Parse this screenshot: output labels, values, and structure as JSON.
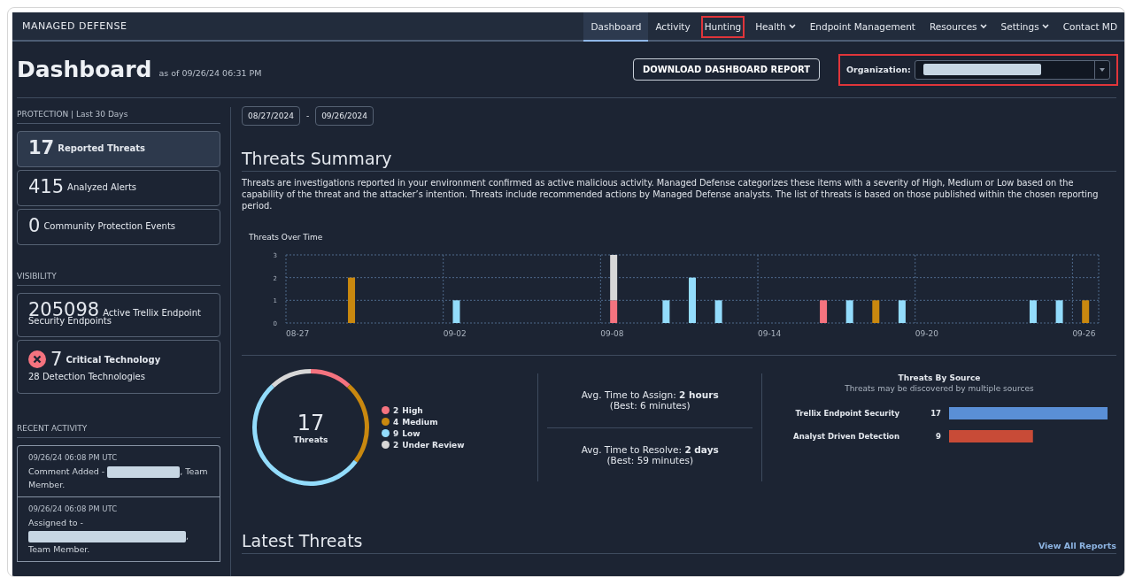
{
  "app": {
    "title": "MANAGED DEFENSE"
  },
  "nav": [
    {
      "label": "Dashboard",
      "selected": true,
      "dropdown": false,
      "highlighted": false
    },
    {
      "label": "Activity",
      "selected": false,
      "dropdown": false,
      "highlighted": false
    },
    {
      "label": "Hunting",
      "selected": false,
      "dropdown": false,
      "highlighted": true
    },
    {
      "label": "Health",
      "selected": false,
      "dropdown": true,
      "highlighted": false
    },
    {
      "label": "Endpoint Management",
      "selected": false,
      "dropdown": false,
      "highlighted": false
    },
    {
      "label": "Resources",
      "selected": false,
      "dropdown": true,
      "highlighted": false
    },
    {
      "label": "Settings",
      "selected": false,
      "dropdown": true,
      "highlighted": false
    },
    {
      "label": "Contact MD",
      "selected": false,
      "dropdown": false,
      "highlighted": false
    }
  ],
  "header": {
    "title": "Dashboard",
    "timestamp": "as of 09/26/24 06:31 PM",
    "download_button": "DOWNLOAD DASHBOARD REPORT",
    "organization": {
      "label": "Organization:",
      "redacted": true,
      "highlighted": true
    }
  },
  "protection": {
    "title": "PROTECTION | Last 30 Days",
    "cards": [
      {
        "value": "17",
        "label": "Reported Threats",
        "selected": true
      },
      {
        "value": "415",
        "label": "Analyzed Alerts",
        "selected": false
      },
      {
        "value": "0",
        "label": "Community Protection Events",
        "selected": false
      }
    ]
  },
  "visibility": {
    "title": "VISIBILITY",
    "cards": [
      {
        "kind": "count",
        "value": "205098",
        "label": "Active Trellix Endpoint Security Endpoints"
      },
      {
        "kind": "critical",
        "value": "7",
        "label": "Critical Technology",
        "sub": "28 Detection Technologies"
      }
    ]
  },
  "recent_activity": {
    "title": "RECENT ACTIVITY",
    "items": [
      {
        "time": "09/26/24 06:08 PM UTC",
        "before": "Comment Added -",
        "redacted": true,
        "after": ", Team Member.",
        "wide": false
      },
      {
        "time": "09/26/24 06:08 PM UTC",
        "before": "Assigned to -",
        "redacted": true,
        "after": ", Team Member.",
        "wide": true
      }
    ]
  },
  "date_range": {
    "from": "08/27/2024",
    "separator": "-",
    "to": "09/26/2024"
  },
  "summary": {
    "title": "Threats Summary",
    "description": "Threats are investigations reported in your environment confirmed as active malicious activity. Managed Defense categorizes these items with a severity of High, Medium or Low based on the capability of the threat and the attacker’s intention. Threats include recommended actions by Managed Defense analysts. The list of threats is based on those published within the chosen reporting period.",
    "chart_data": {
      "type": "bar",
      "title": "Threats Over Time",
      "stacked": true,
      "categories": [
        "08-27",
        null,
        null,
        null,
        null,
        null,
        "09-02",
        null,
        null,
        null,
        null,
        null,
        "09-08",
        null,
        null,
        null,
        null,
        null,
        "09-14",
        null,
        null,
        null,
        null,
        null,
        "09-20",
        null,
        null,
        null,
        null,
        null,
        "09-26"
      ],
      "series": [
        {
          "color": "#f5737f",
          "values": [
            0,
            0,
            0,
            0,
            0,
            0,
            0,
            0,
            0,
            0,
            0,
            0,
            1,
            0,
            0,
            0,
            0,
            0,
            0,
            0,
            1,
            0,
            0,
            0,
            0,
            0,
            0,
            0,
            0,
            0,
            0
          ]
        },
        {
          "color": "#c9880f",
          "values": [
            0,
            0,
            2,
            0,
            0,
            0,
            0,
            0,
            0,
            0,
            0,
            0,
            0,
            0,
            0,
            0,
            0,
            0,
            0,
            0,
            0,
            0,
            1,
            0,
            0,
            0,
            0,
            0,
            0,
            0,
            1
          ]
        },
        {
          "color": "#93dcfc",
          "values": [
            0,
            0,
            0,
            0,
            0,
            0,
            1,
            0,
            0,
            0,
            0,
            0,
            0,
            0,
            1,
            2,
            1,
            0,
            0,
            0,
            0,
            1,
            0,
            1,
            0,
            0,
            0,
            0,
            1,
            1,
            0
          ]
        },
        {
          "color": "#d7d7d7",
          "values": [
            0,
            0,
            0,
            0,
            0,
            0,
            0,
            0,
            0,
            0,
            0,
            0,
            2,
            0,
            0,
            0,
            0,
            0,
            0,
            0,
            0,
            0,
            0,
            0,
            0,
            0,
            0,
            0,
            0,
            0,
            0
          ]
        }
      ],
      "ylim": [
        0,
        3
      ],
      "yticks": [
        0,
        1,
        2,
        3
      ]
    }
  },
  "severity": {
    "total": "17",
    "total_label": "Threats",
    "legend": [
      {
        "count": "2",
        "label": "High",
        "color": "#f5737f"
      },
      {
        "count": "4",
        "label": "Medium",
        "color": "#c9880f"
      },
      {
        "count": "9",
        "label": "Low",
        "color": "#93dcfc"
      },
      {
        "count": "2",
        "label": "Under Review",
        "color": "#d7d7d7"
      }
    ]
  },
  "times": [
    {
      "text": "Avg. Time to Assign: **2 hours**",
      "best": "(Best: 6 minutes)"
    },
    {
      "text": "Avg. Time to Resolve: **2 days**",
      "best": "(Best: 59 minutes)"
    }
  ],
  "sources": {
    "title": "Threats By Source",
    "subtitle": "Threats may be discovered by multiple sources",
    "chart_data": {
      "type": "bar",
      "orientation": "horizontal",
      "categories": [
        "Trellix Endpoint Security",
        "Analyst Driven Detection"
      ],
      "values": [
        17,
        9
      ],
      "colors": [
        "#5a8fd6",
        "#c84b37"
      ],
      "data_labels": true
    }
  },
  "latest": {
    "title": "Latest Threats",
    "link": "View All Reports"
  }
}
